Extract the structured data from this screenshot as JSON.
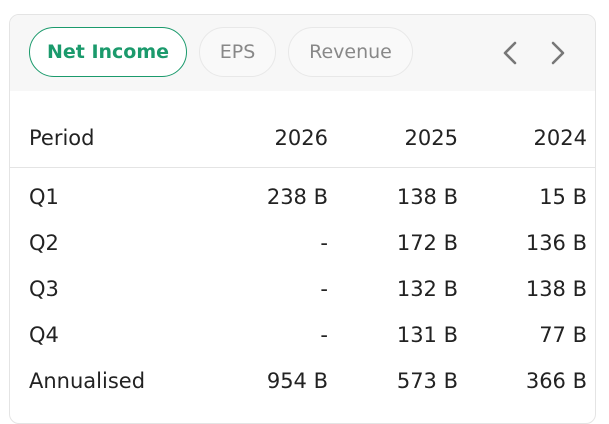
{
  "tabs": [
    {
      "label": "Net Income",
      "active": true
    },
    {
      "label": "EPS",
      "active": false
    },
    {
      "label": "Revenue",
      "active": false
    }
  ],
  "nav": {
    "prev_icon": "chevron-left-icon",
    "next_icon": "chevron-right-icon"
  },
  "table": {
    "headers": [
      "Period",
      "2026",
      "2025",
      "2024"
    ],
    "rows": [
      [
        "Q1",
        "238 B",
        "138 B",
        "15 B"
      ],
      [
        "Q2",
        "-",
        "172 B",
        "136 B"
      ],
      [
        "Q3",
        "-",
        "132 B",
        "138 B"
      ],
      [
        "Q4",
        "-",
        "131 B",
        "77 B"
      ],
      [
        "Annualised",
        "954 B",
        "573 B",
        "366 B"
      ]
    ]
  },
  "colors": {
    "accent": "#1b9a6c",
    "muted_text": "#888888",
    "text": "#222222",
    "border": "#e4e4e4"
  }
}
